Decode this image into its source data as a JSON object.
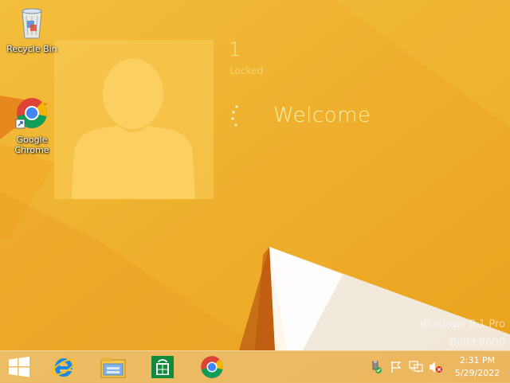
{
  "desktop": {
    "icons": [
      {
        "label": "Recycle Bin",
        "icon": "recycle-bin-icon"
      },
      {
        "label": "Google Chrome",
        "icon": "chrome-icon"
      }
    ]
  },
  "lock": {
    "count": "1",
    "status": "Locked",
    "message": "Welcome"
  },
  "watermark": {
    "line1": "Windows 8.1 Pro",
    "line2": "Build 9600"
  },
  "taskbar": {
    "pinned": [
      {
        "name": "Start",
        "icon": "windows-logo-icon"
      },
      {
        "name": "Internet Explorer",
        "icon": "internet-explorer-icon"
      },
      {
        "name": "File Explorer",
        "icon": "file-explorer-icon"
      },
      {
        "name": "Store",
        "icon": "store-icon"
      },
      {
        "name": "Google Chrome",
        "icon": "chrome-icon"
      }
    ],
    "tray": {
      "icons": [
        "usb-icon",
        "flag-icon",
        "network-icon",
        "volume-muted-icon"
      ]
    },
    "clock": {
      "time": "2:31 PM",
      "date": "5/29/2022"
    }
  },
  "colors": {
    "accent": "#efb22b",
    "tile": "#f8c84a",
    "welcome_text": "#ffeeaf"
  }
}
